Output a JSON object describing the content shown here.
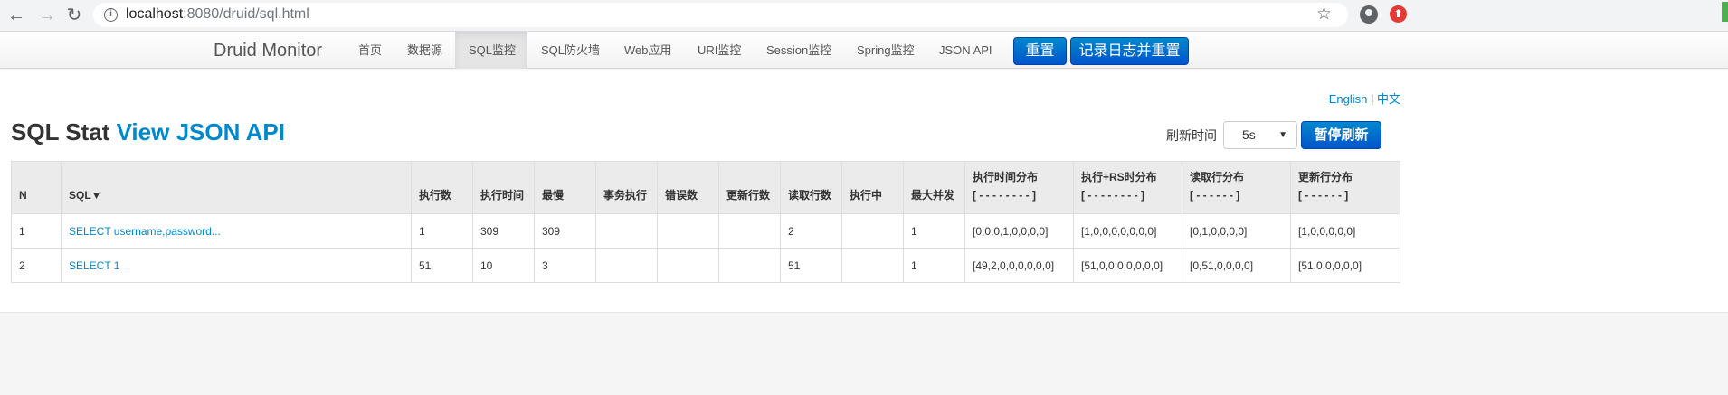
{
  "browser": {
    "url_host": "localhost",
    "url_path": ":8080/druid/sql.html",
    "info_icon": "info-icon",
    "star_icon": "star-icon"
  },
  "navbar": {
    "brand": "Druid Monitor",
    "items": [
      {
        "label": "首页"
      },
      {
        "label": "数据源"
      },
      {
        "label": "SQL监控",
        "active": true
      },
      {
        "label": "SQL防火墙"
      },
      {
        "label": "Web应用"
      },
      {
        "label": "URI监控"
      },
      {
        "label": "Session监控"
      },
      {
        "label": "Spring监控"
      },
      {
        "label": "JSON API"
      }
    ],
    "reset_label": "重置",
    "log_reset_label": "记录日志并重置",
    "accent": "#0088cc"
  },
  "lang": {
    "english": "English",
    "separator": "|",
    "chinese": "中文"
  },
  "title": {
    "main": "SQL Stat",
    "link": "View JSON API"
  },
  "refresh": {
    "label": "刷新时间",
    "selected": "5s",
    "pause_label": "暂停刷新"
  },
  "table": {
    "columns": [
      {
        "l1": "N",
        "l2": ""
      },
      {
        "l1": "SQL▼",
        "l2": ""
      },
      {
        "l1": "执行数",
        "l2": ""
      },
      {
        "l1": "执行时间",
        "l2": ""
      },
      {
        "l1": "最慢",
        "l2": ""
      },
      {
        "l1": "事务执行",
        "l2": ""
      },
      {
        "l1": "错误数",
        "l2": ""
      },
      {
        "l1": "更新行数",
        "l2": ""
      },
      {
        "l1": "读取行数",
        "l2": ""
      },
      {
        "l1": "执行中",
        "l2": ""
      },
      {
        "l1": "最大并发",
        "l2": ""
      },
      {
        "l1": "执行时间分布",
        "l2": "[ - - - - - - - - ]"
      },
      {
        "l1": "执行+RS时分布",
        "l2": "[ - - - - - - - - ]"
      },
      {
        "l1": "读取行分布",
        "l2": "[ - - - - - - ]"
      },
      {
        "l1": "更新行分布",
        "l2": "[ - - - - - - ]"
      }
    ],
    "rows": [
      [
        "1",
        "SELECT username,password...",
        "1",
        "309",
        "309",
        "",
        "",
        "",
        "2",
        "",
        "1",
        "[0,0,0,1,0,0,0,0]",
        "[1,0,0,0,0,0,0,0]",
        "[0,1,0,0,0,0]",
        "[1,0,0,0,0,0]"
      ],
      [
        "2",
        "SELECT 1",
        "51",
        "10",
        "3",
        "",
        "",
        "",
        "51",
        "",
        "1",
        "[49,2,0,0,0,0,0,0]",
        "[51,0,0,0,0,0,0,0]",
        "[0,51,0,0,0,0]",
        "[51,0,0,0,0,0]"
      ]
    ]
  }
}
